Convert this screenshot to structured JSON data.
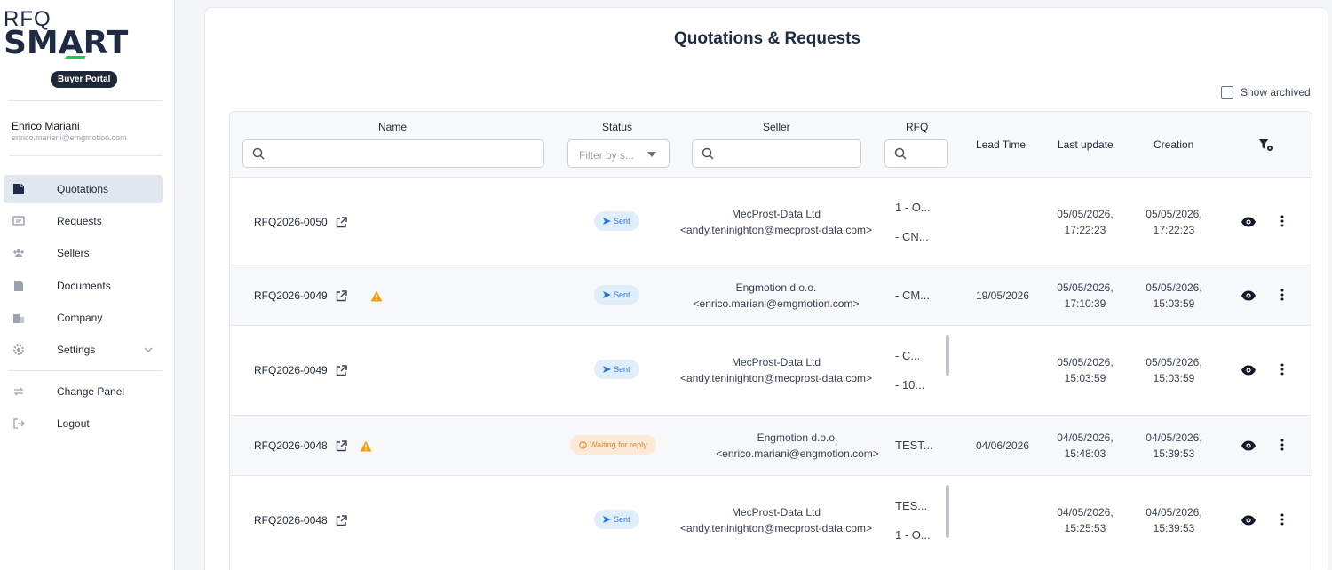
{
  "logo": {
    "top": "RFQ",
    "main": "SMART"
  },
  "portal_badge": "Buyer Portal",
  "user": {
    "name": "Enrico Mariani",
    "email": "enrico.mariani@emgmotion.com"
  },
  "nav": [
    {
      "label": "Quotations",
      "icon": "quotations-icon",
      "active": true
    },
    {
      "label": "Requests",
      "icon": "requests-icon"
    },
    {
      "label": "Sellers",
      "icon": "sellers-icon"
    },
    {
      "label": "Documents",
      "icon": "documents-icon"
    },
    {
      "label": "Company",
      "icon": "company-icon"
    },
    {
      "label": "Settings",
      "icon": "settings-icon",
      "expandable": true
    },
    {
      "label": "Change Panel",
      "icon": "change-panel-icon"
    },
    {
      "label": "Logout",
      "icon": "logout-icon"
    }
  ],
  "page_title": "Quotations & Requests",
  "show_archived": "Show archived",
  "columns": {
    "name": "Name",
    "status": "Status",
    "seller": "Seller",
    "rfq": "RFQ",
    "lead_time": "Lead Time",
    "last_update": "Last update",
    "creation": "Creation"
  },
  "status_filter_placeholder": "Filter by s...",
  "rows": [
    {
      "id": "RFQ2026-0050",
      "warning": false,
      "status": "Sent",
      "seller_name": "MecProst-Data Ltd",
      "seller_email": "<andy.teninighton@mecprost-data.com>",
      "rfq": [
        "1 - O...",
        "- CN..."
      ],
      "lead_time": "",
      "last_update": [
        "05/05/2026,",
        "17:22:23"
      ],
      "creation": [
        "05/05/2026,",
        "17:22:23"
      ]
    },
    {
      "id": "RFQ2026-0049",
      "warning": true,
      "status": "Sent",
      "seller_name": "Engmotion d.o.o.",
      "seller_email": "<enrico.mariani@emgmotion.com>",
      "rfq": [
        "- CM..."
      ],
      "lead_time": "19/05/2026",
      "last_update": [
        "05/05/2026,",
        "17:10:39"
      ],
      "creation": [
        "05/05/2026,",
        "15:03:59"
      ]
    },
    {
      "id": "RFQ2026-0049",
      "warning": false,
      "status": "Sent",
      "seller_name": "MecProst-Data Ltd",
      "seller_email": "<andy.teninighton@mecprost-data.com>",
      "rfq": [
        "- C...",
        "- 10..."
      ],
      "lead_time": "",
      "last_update": [
        "05/05/2026,",
        "15:03:59"
      ],
      "creation": [
        "05/05/2026,",
        "15:03:59"
      ]
    },
    {
      "id": "RFQ2026-0048",
      "warning": true,
      "status": "Waiting for reply",
      "seller_name": "Engmotion d.o.o.",
      "seller_email": "<enrico.mariani@engmotion.com>",
      "rfq": [
        "TEST..."
      ],
      "lead_time": "04/06/2026",
      "last_update": [
        "04/05/2026,",
        "15:48:03"
      ],
      "creation": [
        "04/05/2026,",
        "15:39:53"
      ]
    },
    {
      "id": "RFQ2026-0048",
      "warning": false,
      "status": "Sent",
      "seller_name": "MecProst-Data Ltd",
      "seller_email": "<andy.teninighton@mecprost-data.com>",
      "rfq": [
        "TES...",
        "1 - O..."
      ],
      "lead_time": "",
      "last_update": [
        "04/05/2026,",
        "15:25:53"
      ],
      "creation": [
        "04/05/2026,",
        "15:39:53"
      ]
    }
  ],
  "colors": {
    "sent_bg": "#e0eefc",
    "sent_fg": "#2b7bd8",
    "wait_bg": "#fde9d7",
    "wait_fg": "#e08a2e",
    "warning": "#f59e0b",
    "brand_dark": "#1f2a44",
    "brand_accent": "#22c55e"
  }
}
